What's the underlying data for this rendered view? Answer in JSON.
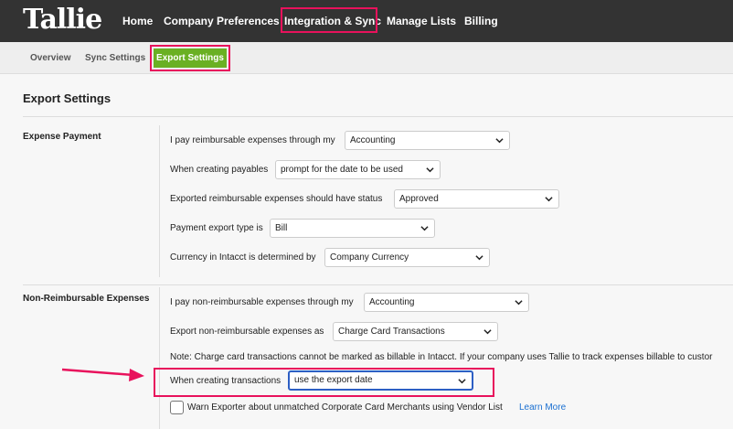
{
  "app": {
    "logo": "Tallie"
  },
  "nav": {
    "items": [
      {
        "label": "Home"
      },
      {
        "label": "Company Preferences"
      },
      {
        "label": "Integration & Sync"
      },
      {
        "label": "Manage Lists"
      },
      {
        "label": "Billing"
      }
    ],
    "active": "Integration & Sync"
  },
  "subnav": {
    "items": [
      {
        "label": "Overview"
      },
      {
        "label": "Sync Settings"
      },
      {
        "label": "Export Settings"
      }
    ],
    "active": "Export Settings"
  },
  "page": {
    "title": "Export Settings"
  },
  "expense_payment": {
    "title": "Expense Payment",
    "rows": [
      {
        "label": "I pay reimbursable expenses through my",
        "value": "Accounting"
      },
      {
        "label": "When creating payables",
        "value": "prompt for the date to be used"
      },
      {
        "label": "Exported reimbursable expenses should have status",
        "value": "Approved"
      },
      {
        "label": "Payment export type is",
        "value": "Bill"
      },
      {
        "label": "Currency in Intacct is determined by",
        "value": "Company Currency"
      }
    ]
  },
  "non_reimbursable": {
    "title": "Non-Reimbursable Expenses",
    "rows": [
      {
        "label": "I pay non-reimbursable expenses through my",
        "value": "Accounting"
      },
      {
        "label": "Export non-reimbursable expenses as",
        "value": "Charge Card Transactions"
      }
    ],
    "note": "Note: Charge card transactions cannot be marked as billable in Intacct. If your company uses Tallie to track expenses billable to custor",
    "transactions": {
      "label": "When creating transactions",
      "value": "use the export date"
    },
    "warn": {
      "label": "Warn Exporter about unmatched Corporate Card Merchants using Vendor List",
      "checked": false,
      "link": "Learn More"
    }
  },
  "colors": {
    "highlight": "#e8125c",
    "active_tab": "#6ab023",
    "topbar": "#333333",
    "link": "#1a6fd1"
  }
}
